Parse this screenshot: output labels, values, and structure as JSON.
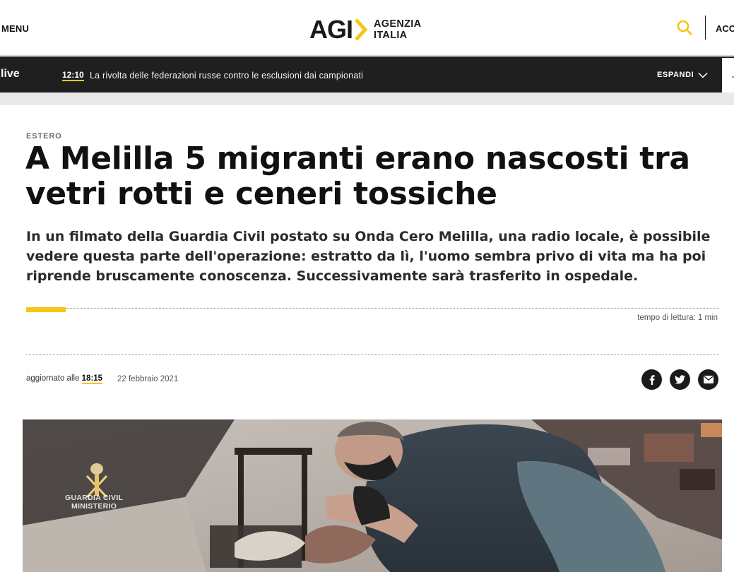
{
  "header": {
    "menu_label": "MENU",
    "logo_mark": "AGI",
    "logo_line1": "AGENZIA",
    "logo_line2": "ITALIA",
    "access_label": "ACC",
    "accent_color": "#f5c518"
  },
  "livebar": {
    "label": "live",
    "time": "12:10",
    "headline": "La rivolta delle federazioni russe contro le esclusioni dai campionati",
    "expand_label": "ESPANDI"
  },
  "article": {
    "section": "ESTERO",
    "title": "A Melilla 5 migranti erano nascosti tra vetri rotti e ceneri tossiche",
    "lead": "In un filmato della Guardia Civil postato su Onda Cero Melilla, una radio locale, è possibile vedere questa parte dell'operazione: estratto da lì, l'uomo sembra privo di vita ma ha poi riprende bruscamente conoscenza. Successivamente sarà trasferito in ospedale.",
    "reading_time": "tempo di lettura: 1 min",
    "updated_prefix": "aggiornato alle",
    "updated_time": "18:15",
    "date": "22 febbraio 2021"
  },
  "share": {
    "facebook_icon": "facebook-icon",
    "twitter_icon": "twitter-icon",
    "email_icon": "email-icon"
  },
  "photo": {
    "watermark_line1": "GUARDIA CIVIL",
    "watermark_line2": "MINISTERIO"
  }
}
